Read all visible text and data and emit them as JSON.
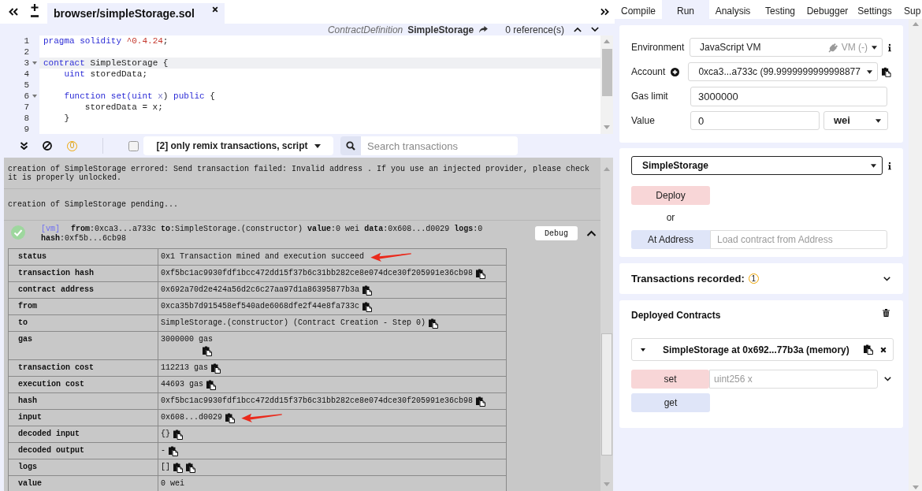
{
  "editor": {
    "tabs": [
      {
        "label": "browser/simpleStorage.sol",
        "selected": true
      }
    ],
    "context_bar": {
      "node_type": "ContractDefinition",
      "node_name": "SimpleStorage",
      "references": "0 reference(s)"
    },
    "code_lines": [
      {
        "number": "1",
        "active": false,
        "foldable": false,
        "tokens": [
          {
            "text": "pragma solidity ",
            "kind": "keyword"
          },
          {
            "text": "^0.4.24",
            "kind": "number"
          },
          {
            "text": ";",
            "kind": "plain"
          }
        ]
      },
      {
        "number": "2",
        "active": false,
        "foldable": false
      },
      {
        "number": "3",
        "active": true,
        "foldable": true,
        "tokens": [
          {
            "text": "contract",
            "kind": "keyword"
          },
          {
            "text": " SimpleStorage {",
            "kind": "plain"
          }
        ]
      },
      {
        "number": "4",
        "active": false,
        "foldable": false,
        "tokens": [
          {
            "text": "    uint",
            "kind": "keyword"
          },
          {
            "text": " storedData;",
            "kind": "plain"
          }
        ]
      },
      {
        "number": "5",
        "active": false,
        "foldable": false
      },
      {
        "number": "6",
        "active": false,
        "foldable": true,
        "tokens": [
          {
            "text": "    function set(uint",
            "kind": "keyword"
          },
          {
            "text": " x",
            "kind": "param"
          },
          {
            "text": ") ",
            "kind": "plain"
          },
          {
            "text": "public",
            "kind": "keyword"
          },
          {
            "text": " {",
            "kind": "plain"
          }
        ]
      },
      {
        "number": "7",
        "active": false,
        "foldable": false,
        "tokens": [
          {
            "text": "        storedData = x;",
            "kind": "plain"
          }
        ]
      },
      {
        "number": "8",
        "active": false,
        "foldable": false,
        "tokens": [
          {
            "text": "    }",
            "kind": "plain"
          }
        ]
      },
      {
        "number": "9",
        "active": false,
        "foldable": false
      }
    ]
  },
  "terminal": {
    "toolbar": {
      "pending_count": "0",
      "filter_checked": false,
      "filter_label": "[2] only remix transactions, script",
      "search_placeholder": "Search transactions"
    },
    "log": [
      {
        "kind": "message",
        "text": "creation of SimpleStorage errored: Send transaction failed: Invalid address . If you use an injected provider, please check it is properly unlocked."
      },
      {
        "kind": "message",
        "text": "creation of SimpleStorage pending..."
      },
      {
        "kind": "transaction",
        "succeeded": true,
        "network": "[vm]",
        "summary": "**from**:0xca3...a733c **to**:SimpleStorage.(constructor) **value**:0 wei **data**:0x608...d0029 **logs**:0 **hash**:0xf5b...6cb98",
        "debug_label": "Debug",
        "expanded": true,
        "details": [
          {
            "key": "status",
            "value": "0x1 Transaction mined and execution succeed",
            "marked": true,
            "icons_below": false
          },
          {
            "key": "transaction hash",
            "value": "0xf5bc1ac9930fdf1bcc472dd15f37b6c31bb282ce8e074dce30f205991e36cb98",
            "copy_buttons": [
              {
                "kind": "copy"
              }
            ],
            "marked": false,
            "icons_below": false
          },
          {
            "key": "contract address",
            "value": "0x692a70d2e424a56d2c6c27aa97d1a86395877b3a",
            "copy_buttons": [
              {
                "kind": "copy"
              }
            ],
            "marked": false,
            "icons_below": false
          },
          {
            "key": "from",
            "value": "0xca35b7d915458ef540ade6068dfe2f44e8fa733c",
            "copy_buttons": [
              {
                "kind": "copy"
              }
            ],
            "marked": false,
            "icons_below": false
          },
          {
            "key": "to",
            "value": "SimpleStorage.(constructor) (Contract Creation - Step 0)",
            "copy_buttons": [
              {
                "kind": "copy"
              }
            ],
            "marked": false,
            "icons_below": false
          },
          {
            "key": "gas",
            "value": "3000000 gas",
            "copy_buttons": [
              {
                "kind": "copy"
              }
            ],
            "marked": false,
            "icons_below": true
          },
          {
            "key": "transaction cost",
            "value": "112213 gas",
            "copy_buttons": [
              {
                "kind": "copy"
              }
            ],
            "marked": false,
            "icons_below": false
          },
          {
            "key": "execution cost",
            "value": "44693 gas",
            "copy_buttons": [
              {
                "kind": "copy"
              }
            ],
            "marked": false,
            "icons_below": false
          },
          {
            "key": "hash",
            "value": "0xf5bc1ac9930fdf1bcc472dd15f37b6c31bb282ce8e074dce30f205991e36cb98",
            "copy_buttons": [
              {
                "kind": "copy"
              }
            ],
            "marked": false,
            "icons_below": false
          },
          {
            "key": "input",
            "value": "0x608...d0029",
            "copy_buttons": [
              {
                "kind": "copy"
              }
            ],
            "marked": true,
            "icons_below": false
          },
          {
            "key": "decoded input",
            "value": "{}",
            "copy_buttons": [
              {
                "kind": "copy"
              }
            ],
            "marked": false,
            "icons_below": false
          },
          {
            "key": "decoded output",
            "value": "-",
            "copy_buttons": [
              {
                "kind": "copy"
              }
            ],
            "marked": false,
            "icons_below": false
          },
          {
            "key": "logs",
            "value": "[]",
            "copy_buttons": [
              {
                "kind": "copy"
              },
              {
                "kind": "copy"
              }
            ],
            "marked": false,
            "icons_below": false
          },
          {
            "key": "value",
            "value": "0 wei",
            "marked": false,
            "icons_below": false
          }
        ]
      }
    ]
  },
  "run_tabs": [
    {
      "label": "Compile",
      "selected": false
    },
    {
      "label": "Run",
      "selected": true
    },
    {
      "label": "Analysis",
      "selected": false
    },
    {
      "label": "Testing",
      "selected": false
    },
    {
      "label": "Debugger",
      "selected": false
    },
    {
      "label": "Settings",
      "selected": false
    },
    {
      "label": "Sup",
      "selected": false
    }
  ],
  "run_panel": {
    "environment": {
      "label": "Environment",
      "value": "JavaScript VM",
      "network": "VM (-)"
    },
    "account": {
      "label": "Account",
      "value": "0xca3...a733c (99.9999999999998877"
    },
    "gas_limit": {
      "label": "Gas limit",
      "value": "3000000"
    },
    "value": {
      "label": "Value",
      "amount": "0",
      "unit": "wei"
    },
    "contract_select": "SimpleStorage",
    "deploy_label": "Deploy",
    "or_label": "or",
    "at_address": {
      "label": "At Address",
      "placeholder": "Load contract from Address"
    },
    "transactions_recorded": {
      "label": "Transactions recorded:",
      "count": "1",
      "expanded": false
    },
    "deployed_contracts": {
      "title": "Deployed Contracts",
      "instances": [
        {
          "title": "SimpleStorage at 0x692...77b3a (memory)",
          "expanded": true,
          "functions": [
            {
              "name": "set",
              "kind": "transact",
              "placeholder": "uint256 x"
            },
            {
              "name": "get",
              "kind": "call"
            }
          ]
        }
      ]
    }
  }
}
